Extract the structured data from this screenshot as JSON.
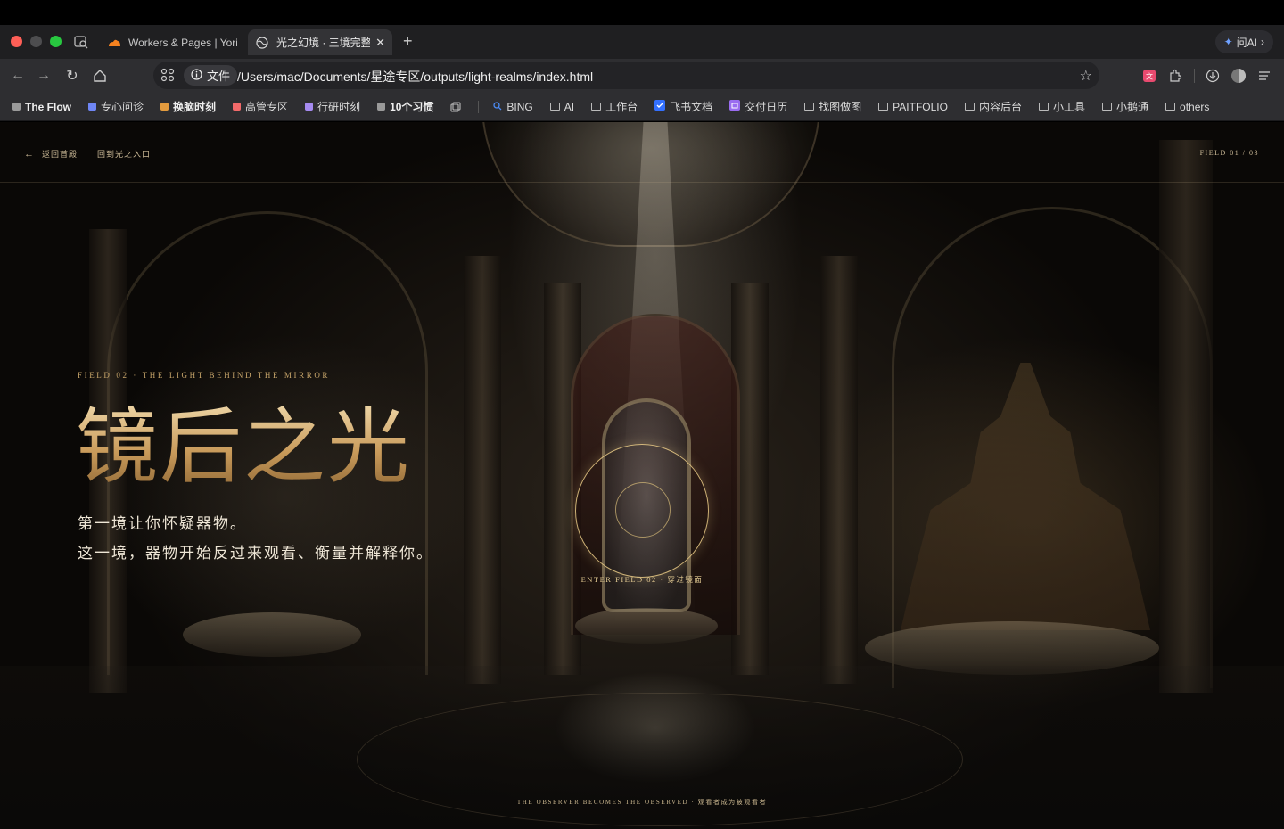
{
  "browser": {
    "tabs": [
      {
        "title": "Workers & Pages | Yori",
        "active": false
      },
      {
        "title": "光之幻境 · 三境完整",
        "active": true
      }
    ],
    "ask_ai_label": "问AI",
    "omnibox": {
      "scheme_label": "文件",
      "url": "/Users/mac/Documents/星途专区/outputs/light-realms/index.html"
    },
    "bookmarks": [
      {
        "label": "The Flow",
        "color": "#9a9a9a",
        "kind": "dot",
        "bold": true
      },
      {
        "label": "专心问诊",
        "color": "#6f86f5",
        "kind": "dot",
        "bold": false
      },
      {
        "label": "换脑时刻",
        "color": "#e39b3e",
        "kind": "dot",
        "bold": true
      },
      {
        "label": "高管专区",
        "color": "#f26a6a",
        "kind": "dot",
        "bold": false
      },
      {
        "label": "行研时刻",
        "color": "#a58af0",
        "kind": "dot",
        "bold": false
      },
      {
        "label": "10个习惯",
        "color": "#9a9a9a",
        "kind": "dot",
        "bold": true
      },
      {
        "label": "BING",
        "kind": "search"
      },
      {
        "label": "AI",
        "kind": "folder"
      },
      {
        "label": "工作台",
        "kind": "folder"
      },
      {
        "label": "飞书文档",
        "kind": "app"
      },
      {
        "label": "交付日历",
        "kind": "app2"
      },
      {
        "label": "找图做图",
        "kind": "folder"
      },
      {
        "label": "PAITFOLIO",
        "kind": "folder"
      },
      {
        "label": "内容后台",
        "kind": "folder"
      },
      {
        "label": "小工具",
        "kind": "folder"
      },
      {
        "label": "小鹅通",
        "kind": "folder"
      },
      {
        "label": "others",
        "kind": "folder"
      }
    ]
  },
  "page": {
    "nav": {
      "back_label": "返回首殿",
      "entry_label": "回到光之入口",
      "field_counter": "FIELD 01 / 03"
    },
    "hero": {
      "eyebrow": "FIELD 02 · THE LIGHT BEHIND THE MIRROR",
      "title": "镜后之光",
      "subtitle_line1": "第一境让你怀疑器物。",
      "subtitle_line2": "这一境，器物开始反过来观看、衡量并解释你。"
    },
    "portal": {
      "label": "ENTER FIELD 02 · 穿过镜面"
    },
    "footer": "THE OBSERVER BECOMES THE OBSERVED · 观看者成为被观看者"
  },
  "colors": {
    "accent_gold": "#c7a56a",
    "tab_active_bg": "#333336",
    "chrome_bg": "#2e2e31"
  }
}
